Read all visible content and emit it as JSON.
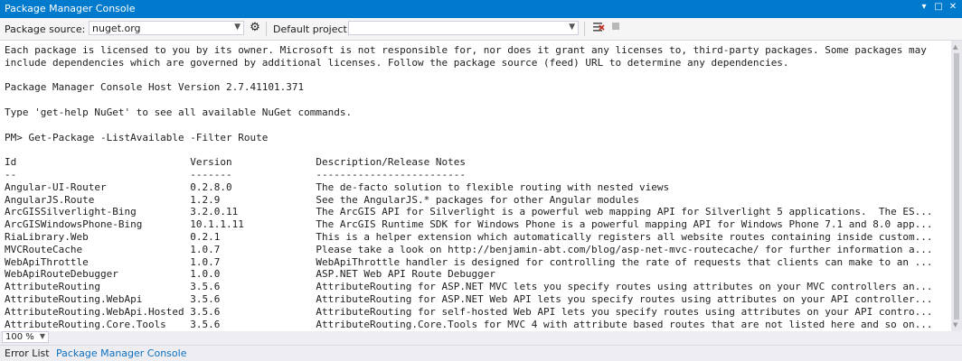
{
  "window": {
    "title": "Package Manager Console",
    "controls": [
      "▾",
      "□",
      "✕"
    ]
  },
  "toolbar": {
    "package_source_label": "Package source:",
    "package_source_value": "nuget.org",
    "settings_icon": "gear-icon",
    "default_project_label": "Default project:",
    "default_project_value": "",
    "clear_icon": "clear-console-icon",
    "stop_icon": "stop-icon"
  },
  "console": {
    "lines": [
      "Each package is licensed to you by its owner. Microsoft is not responsible for, nor does it grant any licenses to, third-party packages. Some packages may",
      "include dependencies which are governed by additional licenses. Follow the package source (feed) URL to determine any dependencies.",
      "",
      "Package Manager Console Host Version 2.7.41101.371",
      "",
      "Type 'get-help NuGet' to see all available NuGet commands.",
      "",
      "PM> Get-Package -ListAvailable -Filter Route",
      "",
      "Id                             Version              Description/Release Notes",
      "--                             -------              -------------------------",
      "Angular-UI-Router              0.2.8.0              The de-facto solution to flexible routing with nested views",
      "AngularJS.Route                1.2.9                See the AngularJS.* packages for other Angular modules",
      "ArcGISSilverlight-Bing         3.2.0.11             The ArcGIS API for Silverlight is a powerful web mapping API for Silverlight 5 applications.  The ES...",
      "ArcGISWindowsPhone-Bing        10.1.1.11            The ArcGIS Runtime SDK for Windows Phone is a powerful mapping API for Windows Phone 7.1 and 8.0 app...",
      "RiaLibrary.Web                 0.2.1                This is a helper extension which automatically registers all website routes containing inside custom...",
      "MVCRouteCache                  1.0.7                Please take a look on http://benjamin-abt.com/blog/asp-net-mvc-routecache/ for further information a...",
      "WebApiThrottle                 1.0.7                WebApiThrottle handler is designed for controlling the rate of requests that clients can make to an ...",
      "WebApiRouteDebugger            1.0.0                ASP.NET Web API Route Debugger",
      "AttributeRouting               3.5.6                AttributeRouting for ASP.NET MVC lets you specify routes using attributes on your MVC controllers an...",
      "AttributeRouting.WebApi        3.5.6                AttributeRouting for ASP.NET Web API lets you specify routes using attributes on your API controller...",
      "AttributeRouting.WebApi.Hosted 3.5.6                AttributeRouting for self-hosted Web API lets you specify routes using attributes on your API contro...",
      "AttributeRouting.Core.Tools    3.5.6                AttributeRouting.Core.Tools for MVC 4 with attribute based routes that are not listed here and so on..."
    ]
  },
  "zoom": {
    "value": "100 %"
  },
  "tabs": [
    {
      "label": "Error List",
      "active": false
    },
    {
      "label": "Package Manager Console",
      "active": true
    }
  ],
  "colors": {
    "titlebar": "#007acc",
    "active_tab": "#0e70c0",
    "background": "#eeeef2"
  }
}
